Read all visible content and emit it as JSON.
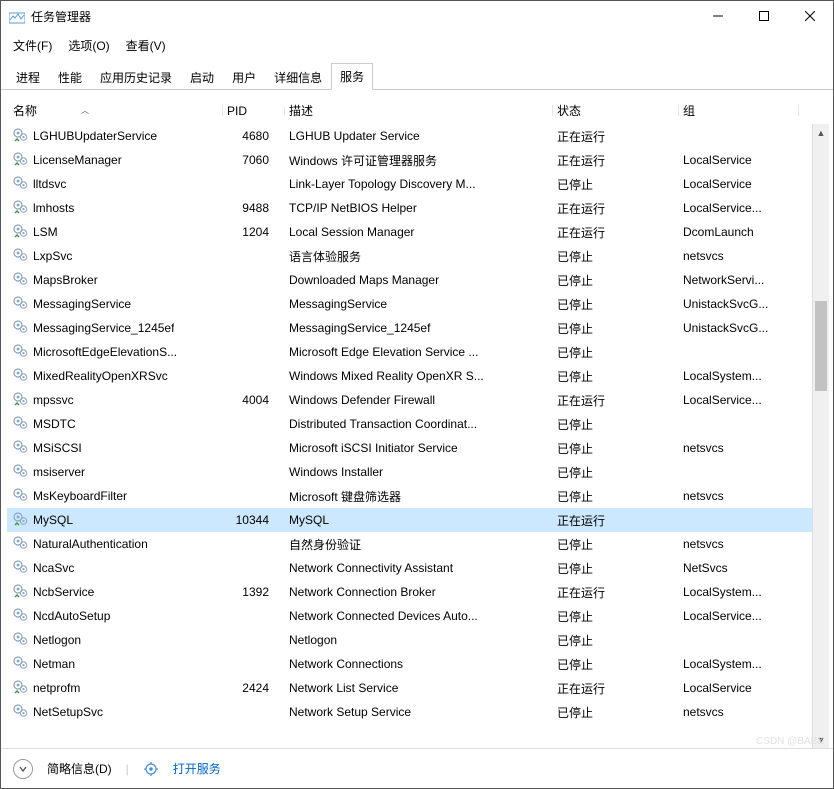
{
  "window": {
    "title": "任务管理器"
  },
  "menu": {
    "file": "文件(F)",
    "options": "选项(O)",
    "view": "查看(V)"
  },
  "tabs": {
    "processes": "进程",
    "performance": "性能",
    "appHistory": "应用历史记录",
    "startup": "启动",
    "users": "用户",
    "details": "详细信息",
    "services": "服务"
  },
  "headers": {
    "name": "名称",
    "pid": "PID",
    "desc": "描述",
    "state": "状态",
    "group": "组"
  },
  "status": {
    "running": "正在运行",
    "stopped": "已停止"
  },
  "footer": {
    "briefInfo": "简略信息(D)",
    "openServices": "打开服务"
  },
  "watermark": "CSDN @BAB&",
  "rows": [
    {
      "name": "LGHUBUpdaterService",
      "pid": "4680",
      "desc": "LGHUB Updater Service",
      "state": "正在运行",
      "group": ""
    },
    {
      "name": "LicenseManager",
      "pid": "7060",
      "desc": "Windows 许可证管理器服务",
      "state": "正在运行",
      "group": "LocalService"
    },
    {
      "name": "lltdsvc",
      "pid": "",
      "desc": "Link-Layer Topology Discovery M...",
      "state": "已停止",
      "group": "LocalService"
    },
    {
      "name": "lmhosts",
      "pid": "9488",
      "desc": "TCP/IP NetBIOS Helper",
      "state": "正在运行",
      "group": "LocalService..."
    },
    {
      "name": "LSM",
      "pid": "1204",
      "desc": "Local Session Manager",
      "state": "正在运行",
      "group": "DcomLaunch"
    },
    {
      "name": "LxpSvc",
      "pid": "",
      "desc": "语言体验服务",
      "state": "已停止",
      "group": "netsvcs"
    },
    {
      "name": "MapsBroker",
      "pid": "",
      "desc": "Downloaded Maps Manager",
      "state": "已停止",
      "group": "NetworkServi..."
    },
    {
      "name": "MessagingService",
      "pid": "",
      "desc": "MessagingService",
      "state": "已停止",
      "group": "UnistackSvcG..."
    },
    {
      "name": "MessagingService_1245ef",
      "pid": "",
      "desc": "MessagingService_1245ef",
      "state": "已停止",
      "group": "UnistackSvcG..."
    },
    {
      "name": "MicrosoftEdgeElevationS...",
      "pid": "",
      "desc": "Microsoft Edge Elevation Service ...",
      "state": "已停止",
      "group": ""
    },
    {
      "name": "MixedRealityOpenXRSvc",
      "pid": "",
      "desc": "Windows Mixed Reality OpenXR S...",
      "state": "已停止",
      "group": "LocalSystem..."
    },
    {
      "name": "mpssvc",
      "pid": "4004",
      "desc": "Windows Defender Firewall",
      "state": "正在运行",
      "group": "LocalService..."
    },
    {
      "name": "MSDTC",
      "pid": "",
      "desc": "Distributed Transaction Coordinat...",
      "state": "已停止",
      "group": ""
    },
    {
      "name": "MSiSCSI",
      "pid": "",
      "desc": "Microsoft iSCSI Initiator Service",
      "state": "已停止",
      "group": "netsvcs"
    },
    {
      "name": "msiserver",
      "pid": "",
      "desc": "Windows Installer",
      "state": "已停止",
      "group": ""
    },
    {
      "name": "MsKeyboardFilter",
      "pid": "",
      "desc": "Microsoft 键盘筛选器",
      "state": "已停止",
      "group": "netsvcs"
    },
    {
      "name": "MySQL",
      "pid": "10344",
      "desc": "MySQL",
      "state": "正在运行",
      "group": "",
      "selected": true
    },
    {
      "name": "NaturalAuthentication",
      "pid": "",
      "desc": "自然身份验证",
      "state": "已停止",
      "group": "netsvcs"
    },
    {
      "name": "NcaSvc",
      "pid": "",
      "desc": "Network Connectivity Assistant",
      "state": "已停止",
      "group": "NetSvcs"
    },
    {
      "name": "NcbService",
      "pid": "1392",
      "desc": "Network Connection Broker",
      "state": "正在运行",
      "group": "LocalSystem..."
    },
    {
      "name": "NcdAutoSetup",
      "pid": "",
      "desc": "Network Connected Devices Auto...",
      "state": "已停止",
      "group": "LocalService..."
    },
    {
      "name": "Netlogon",
      "pid": "",
      "desc": "Netlogon",
      "state": "已停止",
      "group": ""
    },
    {
      "name": "Netman",
      "pid": "",
      "desc": "Network Connections",
      "state": "已停止",
      "group": "LocalSystem..."
    },
    {
      "name": "netprofm",
      "pid": "2424",
      "desc": "Network List Service",
      "state": "正在运行",
      "group": "LocalService"
    },
    {
      "name": "NetSetupSvc",
      "pid": "",
      "desc": "Network Setup Service",
      "state": "已停止",
      "group": "netsvcs"
    }
  ]
}
